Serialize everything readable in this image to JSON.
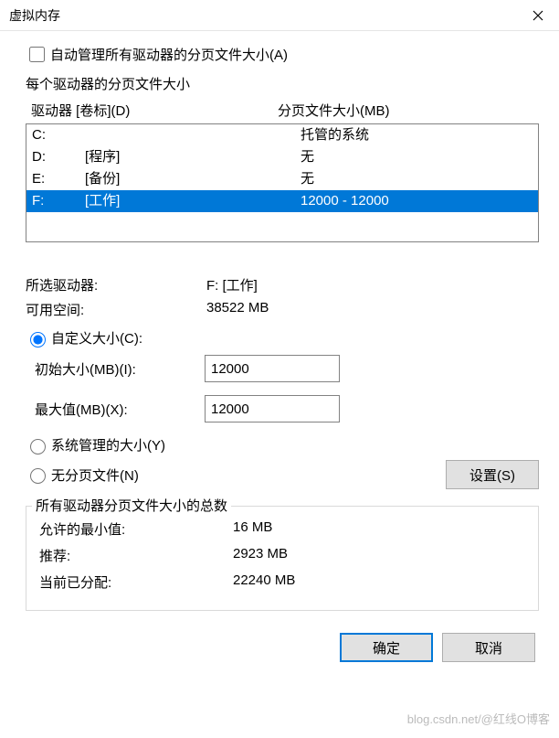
{
  "window": {
    "title": "虚拟内存"
  },
  "auto_manage": {
    "label": "自动管理所有驱动器的分页文件大小(A)",
    "checked": false
  },
  "drive_section_label": "每个驱动器的分页文件大小",
  "headers": {
    "drive": "驱动器 [卷标](D)",
    "size": "分页文件大小(MB)"
  },
  "drives": [
    {
      "letter": "C:",
      "label": "",
      "size": "托管的系统",
      "selected": false
    },
    {
      "letter": "D:",
      "label": "[程序]",
      "size": "无",
      "selected": false
    },
    {
      "letter": "E:",
      "label": "[备份]",
      "size": "无",
      "selected": false
    },
    {
      "letter": "F:",
      "label": "[工作]",
      "size": "12000 - 12000",
      "selected": true
    }
  ],
  "selected_drive": {
    "label_text": "所选驱动器:",
    "value": "F: [工作]",
    "space_label": "可用空间:",
    "space_value": "38522 MB"
  },
  "size_options": {
    "custom_label": "自定义大小(C):",
    "initial_label": "初始大小(MB)(I):",
    "initial_value": "12000",
    "max_label": "最大值(MB)(X):",
    "max_value": "12000",
    "system_label": "系统管理的大小(Y)",
    "none_label": "无分页文件(N)",
    "selected": "custom",
    "set_button": "设置(S)"
  },
  "totals": {
    "title": "所有驱动器分页文件大小的总数",
    "min_label": "允许的最小值:",
    "min_value": "16 MB",
    "rec_label": "推荐:",
    "rec_value": "2923 MB",
    "cur_label": "当前已分配:",
    "cur_value": "22240 MB"
  },
  "buttons": {
    "ok": "确定",
    "cancel": "取消"
  },
  "watermark": "blog.csdn.net/@红线O博客"
}
